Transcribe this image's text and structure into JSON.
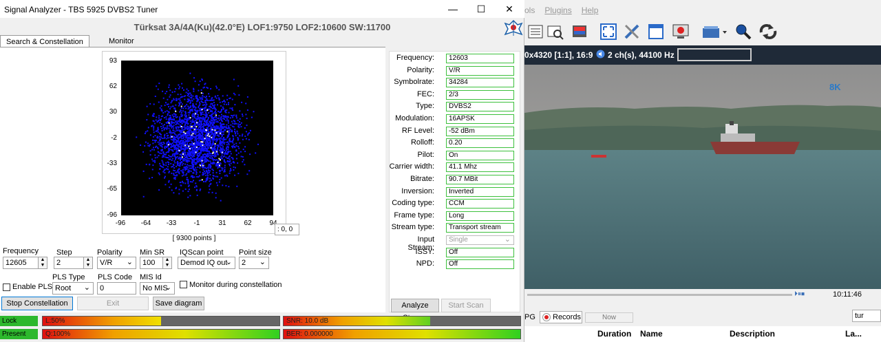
{
  "background_app": {
    "menu": [
      "ols",
      "Plugins",
      "Help"
    ],
    "status": {
      "resolution": "0x4320 [1:1], 16:9",
      "audio": "2 ch(s), 44100 Hz"
    },
    "time": "10:11:46",
    "tabs": [
      "PG",
      "Records",
      "Now"
    ],
    "lang_select": "tur",
    "columns": [
      "Duration",
      "Name",
      "Description",
      "La..."
    ],
    "logo_text": "8K"
  },
  "window": {
    "title": "Signal Analyzer - TBS 5925 DVBS2 Tuner",
    "minimize": "—",
    "maximize": "☐",
    "close": "✕"
  },
  "satellite_header": "Türksat 3A/4A(Ku)(42.0°E) LOF1:9750 LOF2:10600 SW:11700",
  "tabs": {
    "search": "Search & Constellation",
    "monitor": "Monitor"
  },
  "plot": {
    "y_ticks": [
      "93",
      "62",
      "30",
      "-2",
      "-33",
      "-65",
      "-96"
    ],
    "x_ticks": [
      "-96",
      "-64",
      "-33",
      "-1",
      "31",
      "62",
      "94"
    ],
    "points_label": "[ 9300 points ]",
    "coord": ": 0, 0"
  },
  "controls": {
    "frequency_label": "Frequency",
    "frequency": "12605",
    "step_label": "Step",
    "step": "2",
    "polarity_label": "Polarity",
    "polarity": "V/R",
    "minsr_label": "Min SR",
    "minsr": "100",
    "iqscan_label": "IQScan point",
    "iqscan": "Demod IQ out",
    "pointsize_label": "Point size",
    "pointsize": "2",
    "enable_pls": "Enable PLS",
    "plstype_label": "PLS Type",
    "plstype": "Root",
    "plscode_label": "PLS Code",
    "plscode": "0",
    "misid_label": "MIS Id",
    "misid": "No MIS",
    "monitor_during": "Monitor during constellation",
    "stop_btn": "Stop Constellation",
    "exit_btn": "Exit",
    "save_btn": "Save diagram"
  },
  "info": {
    "rows": [
      {
        "label": "Frequency:",
        "value": "12603"
      },
      {
        "label": "Polarity:",
        "value": "V/R"
      },
      {
        "label": "Symbolrate:",
        "value": "34284"
      },
      {
        "label": "FEC:",
        "value": "2/3"
      },
      {
        "label": "Type:",
        "value": "DVBS2"
      },
      {
        "label": "Modulation:",
        "value": "16APSK"
      },
      {
        "label": "RF Level:",
        "value": "-52 dBm"
      },
      {
        "label": "Rolloff:",
        "value": "0.20"
      },
      {
        "label": "Pilot:",
        "value": "On"
      },
      {
        "label": "Carrier width:",
        "value": "41.1 Mhz"
      },
      {
        "label": "Bitrate:",
        "value": "90.7 MBit"
      },
      {
        "label": "Inversion:",
        "value": "Inverted"
      },
      {
        "label": "Coding type:",
        "value": "CCM"
      },
      {
        "label": "Frame type:",
        "value": "Long"
      },
      {
        "label": "Stream type:",
        "value": "Transport stream"
      },
      {
        "label": "Input Stream:",
        "value": "Single"
      },
      {
        "label": "ISSY:",
        "value": "Off"
      },
      {
        "label": "NPD:",
        "value": "Off"
      }
    ],
    "analyze_btn": "Analyze Stream",
    "start_btn": "Start Scan"
  },
  "status_bars": {
    "lock": "Lock",
    "present": "Present",
    "l": "L:50%",
    "l_level": 0.5,
    "q": "Q:100%",
    "q_level": 1.0,
    "snr": "SNR: 10.0 dB",
    "snr_level": 0.62,
    "ber": "BER: 0.000000",
    "ber_level": 1.0
  },
  "colors": {
    "accent_green": "#3cc03c",
    "plot_points": "#1010ff",
    "lock_green": "#2db82d"
  }
}
